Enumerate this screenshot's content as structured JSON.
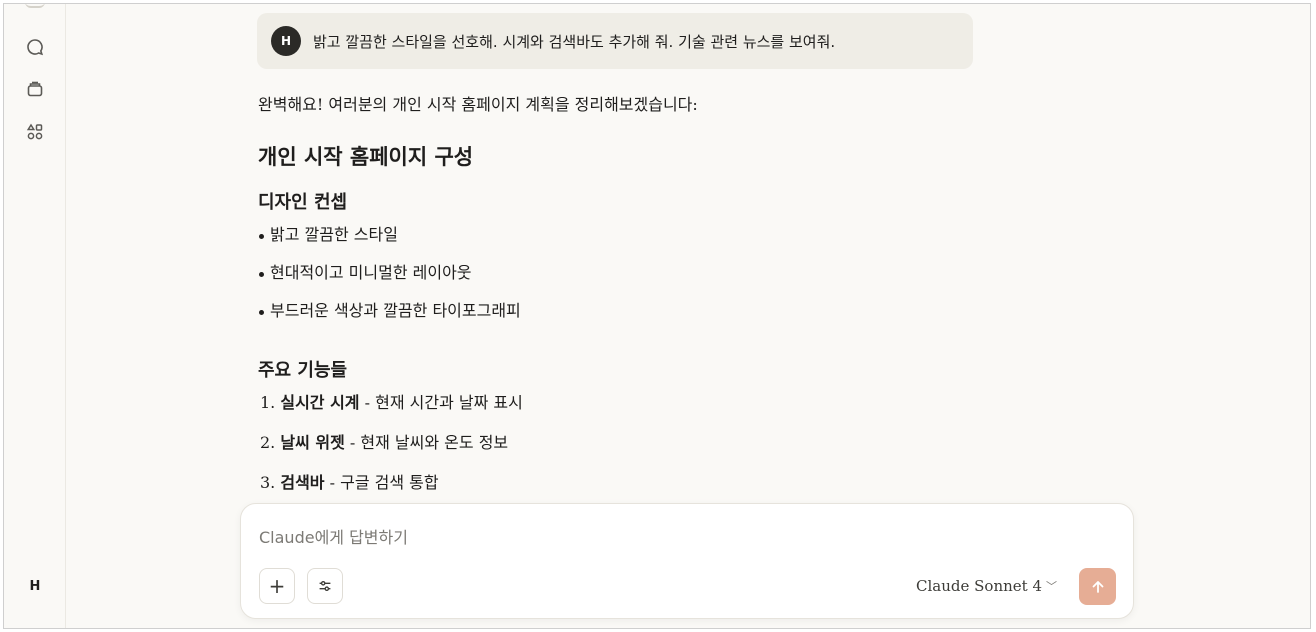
{
  "sidebar": {
    "icons": [
      "chat-icon",
      "projects-icon",
      "artifacts-icon"
    ],
    "user_initial": "H"
  },
  "conversation": {
    "user_message": {
      "avatar_initial": "H",
      "text": "밝고 깔끔한 스타일을 선호해. 시계와 검색바도 추가해 줘. 기술 관련 뉴스를 보여줘."
    },
    "assistant": {
      "intro": "완벽해요! 여러분의 개인 시작 홈페이지 계획을 정리해보겠습니다:",
      "heading": "개인 시작 홈페이지 구성",
      "design_heading": "디자인 컨셉",
      "design_points": [
        "밝고 깔끔한 스타일",
        "현대적이고 미니멀한 레이아웃",
        "부드러운 색상과 깔끔한 타이포그래피"
      ],
      "features_heading": "주요 기능들",
      "features": [
        {
          "num": "1.",
          "name": "실시간 시계",
          "desc": " - 현재 시간과 날짜 표시"
        },
        {
          "num": "2.",
          "name": "날씨 위젯",
          "desc": " - 현재 날씨와 온도 정보"
        },
        {
          "num": "3.",
          "name": "검색바",
          "desc": " - 구글 검색 통합"
        }
      ]
    }
  },
  "composer": {
    "placeholder": "Claude에게 답변하기",
    "model": "Claude Sonnet 4",
    "model_chevron": "﹀",
    "plus_label": "+"
  },
  "colors": {
    "background": "#faf9f6",
    "user_bubble": "#efede6",
    "send_button": "#e6ad95",
    "avatar": "#2b2a27"
  }
}
